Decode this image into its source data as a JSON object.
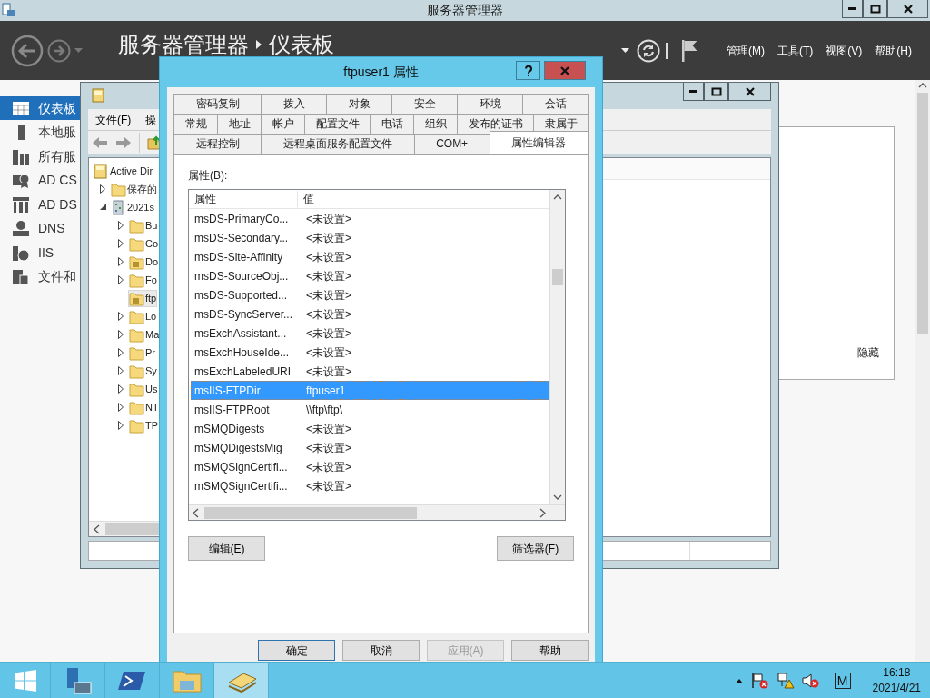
{
  "window": {
    "title": "服务器管理器"
  },
  "header": {
    "breadcrumb": [
      "服务器管理器",
      "仪表板"
    ],
    "menus": [
      "管理(M)",
      "工具(T)",
      "视图(V)",
      "帮助(H)"
    ]
  },
  "sidebar": {
    "items": [
      {
        "label": "仪表板",
        "kind": "dashboard",
        "selected": true
      },
      {
        "label": "本地服",
        "kind": "server",
        "selected": false
      },
      {
        "label": "所有服",
        "kind": "servers",
        "selected": false
      },
      {
        "label": "AD CS",
        "kind": "certificate",
        "selected": false
      },
      {
        "label": "AD DS",
        "kind": "directory",
        "selected": false
      },
      {
        "label": "DNS",
        "kind": "dns",
        "selected": false
      },
      {
        "label": "IIS",
        "kind": "iis",
        "selected": false
      },
      {
        "label": "文件和",
        "kind": "files",
        "selected": false
      }
    ]
  },
  "welcome_panel": {
    "hide_link": "隐藏"
  },
  "ad_window": {
    "menus": [
      "文件(F)",
      "操"
    ],
    "tree": [
      {
        "label": "Active Dir",
        "kind": "root",
        "selected": false,
        "children": [
          {
            "label": "保存的",
            "kind": "folder",
            "expanded": false,
            "selected": false
          },
          {
            "label": "2021s",
            "kind": "domain",
            "expanded": true,
            "selected": false,
            "children": [
              {
                "label": "Bu",
                "kind": "folder",
                "expanded": false,
                "selected": false
              },
              {
                "label": "Co",
                "kind": "folder",
                "expanded": false,
                "selected": false
              },
              {
                "label": "Do",
                "kind": "ou",
                "expanded": false,
                "selected": false
              },
              {
                "label": "Fo",
                "kind": "folder",
                "expanded": false,
                "selected": false
              },
              {
                "label": "ftp",
                "kind": "ou",
                "selected": true
              },
              {
                "label": "Lo",
                "kind": "folder",
                "expanded": false,
                "selected": false
              },
              {
                "label": "Ma",
                "kind": "folder",
                "expanded": false,
                "selected": false
              },
              {
                "label": "Pr",
                "kind": "folder",
                "expanded": false,
                "selected": false
              },
              {
                "label": "Sy",
                "kind": "folder",
                "expanded": false,
                "selected": false
              },
              {
                "label": "Us",
                "kind": "folder",
                "expanded": false,
                "selected": false
              },
              {
                "label": "NT",
                "kind": "folder",
                "expanded": false,
                "selected": false
              },
              {
                "label": "TP",
                "kind": "folder",
                "expanded": false,
                "selected": false
              }
            ]
          }
        ]
      }
    ]
  },
  "dialog": {
    "title": "ftpuser1 属性",
    "tab_rows": [
      [
        {
          "label": "密码复制",
          "selected": false
        },
        {
          "label": "拨入",
          "selected": false
        },
        {
          "label": "对象",
          "selected": false
        },
        {
          "label": "安全",
          "selected": false
        },
        {
          "label": "环境",
          "selected": false
        },
        {
          "label": "会话",
          "selected": false
        }
      ],
      [
        {
          "label": "常规",
          "selected": false
        },
        {
          "label": "地址",
          "selected": false
        },
        {
          "label": "帐户",
          "selected": false
        },
        {
          "label": "配置文件",
          "selected": false
        },
        {
          "label": "电话",
          "selected": false
        },
        {
          "label": "组织",
          "selected": false
        },
        {
          "label": "发布的证书",
          "selected": false
        },
        {
          "label": "隶属于",
          "selected": false
        }
      ],
      [
        {
          "label": "远程控制",
          "selected": false
        },
        {
          "label": "远程桌面服务配置文件",
          "selected": false
        },
        {
          "label": "COM+",
          "selected": false
        },
        {
          "label": "属性编辑器",
          "selected": true
        }
      ]
    ],
    "list_label": "属性(B):",
    "columns": [
      "属性",
      "值"
    ],
    "rows": [
      {
        "name": "msDS-PrimaryCo...",
        "value": "<未设置>",
        "selected": false
      },
      {
        "name": "msDS-Secondary...",
        "value": "<未设置>",
        "selected": false
      },
      {
        "name": "msDS-Site-Affinity",
        "value": "<未设置>",
        "selected": false
      },
      {
        "name": "msDS-SourceObj...",
        "value": "<未设置>",
        "selected": false
      },
      {
        "name": "msDS-Supported...",
        "value": "<未设置>",
        "selected": false
      },
      {
        "name": "msDS-SyncServer...",
        "value": "<未设置>",
        "selected": false
      },
      {
        "name": "msExchAssistant...",
        "value": "<未设置>",
        "selected": false
      },
      {
        "name": "msExchHouseIde...",
        "value": "<未设置>",
        "selected": false
      },
      {
        "name": "msExchLabeledURI",
        "value": "<未设置>",
        "selected": false
      },
      {
        "name": "msIIS-FTPDir",
        "value": "ftpuser1",
        "selected": true
      },
      {
        "name": "msIIS-FTPRoot",
        "value": "\\\\ftp\\ftp\\",
        "selected": false
      },
      {
        "name": "mSMQDigests",
        "value": "<未设置>",
        "selected": false
      },
      {
        "name": "mSMQDigestsMig",
        "value": "<未设置>",
        "selected": false
      },
      {
        "name": "mSMQSignCertifi...",
        "value": "<未设置>",
        "selected": false
      },
      {
        "name": "mSMQSignCertifi...",
        "value": "<未设置>",
        "selected": false
      }
    ],
    "list_buttons": [
      "编辑(E)",
      "筛选器(F)"
    ],
    "footer_buttons": [
      {
        "label": "确定",
        "default": true,
        "disabled": false
      },
      {
        "label": "取消",
        "default": false,
        "disabled": false
      },
      {
        "label": "应用(A)",
        "default": false,
        "disabled": true
      },
      {
        "label": "帮助",
        "default": false,
        "disabled": false
      }
    ]
  },
  "taskbar": {
    "apps": [
      {
        "kind": "server-manager",
        "active": false
      },
      {
        "kind": "powershell",
        "active": false
      },
      {
        "kind": "explorer",
        "active": false
      },
      {
        "kind": "directory",
        "active": true
      }
    ],
    "input_indicator": "M",
    "time": "16:18",
    "date": "2021/4/21"
  }
}
